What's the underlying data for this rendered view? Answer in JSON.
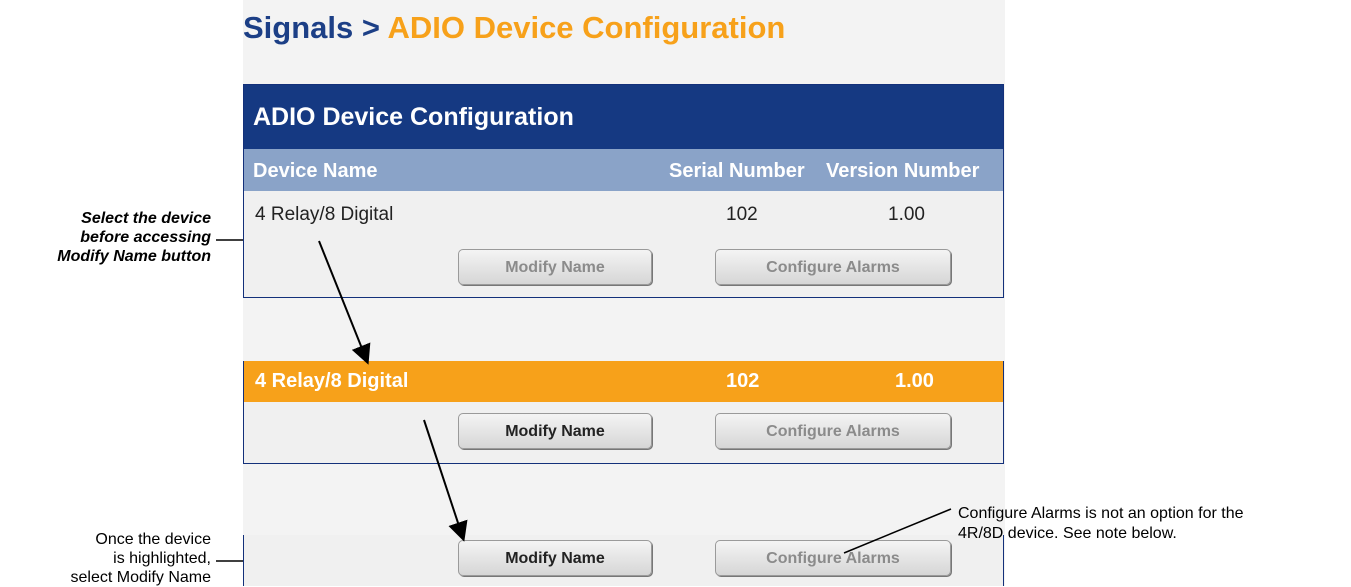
{
  "breadcrumb": {
    "section": "Signals",
    "separator": ">",
    "current": "ADIO Device Configuration"
  },
  "panel": {
    "title": "ADIO Device Configuration",
    "columns": [
      "Device Name",
      "Serial Number",
      "Version Number"
    ]
  },
  "device": {
    "name": "4 Relay/8 Digital",
    "serial": "102",
    "version": "1.00"
  },
  "buttons": {
    "modify_name": "Modify Name",
    "configure_alarms": "Configure Alarms"
  },
  "annotations": {
    "select_device": [
      "Select the device",
      "before accessing",
      "Modify Name button"
    ],
    "once_highlighted": [
      "Once the device",
      "is highlighted,",
      "select Modify Name"
    ],
    "configure_alarms_note": [
      "Configure Alarms is not an option for the",
      "4R/8D device. See note below."
    ]
  },
  "colors": {
    "brand_blue": "#153982",
    "header_blue": "#8aa3c8",
    "highlight_orange": "#f7a11a"
  }
}
